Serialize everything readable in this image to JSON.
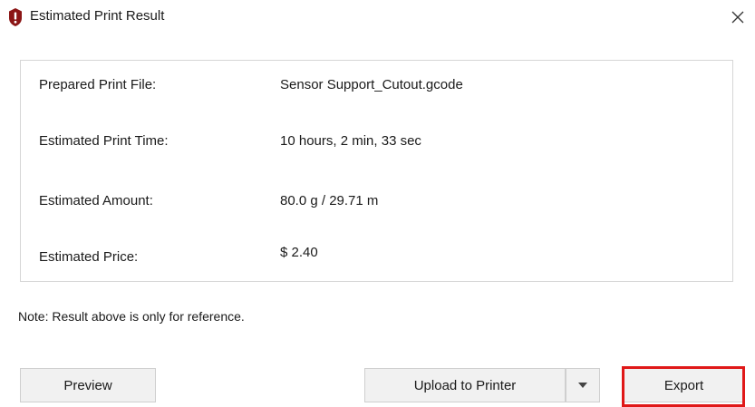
{
  "dialog": {
    "title": "Estimated Print Result",
    "icon": "alert-shield-icon",
    "close_icon": "close-icon"
  },
  "info": {
    "rows": [
      {
        "label": "Prepared Print File:",
        "value": "Sensor Support_Cutout.gcode"
      },
      {
        "label": "Estimated Print Time:",
        "value": "10 hours, 2 min, 33 sec"
      },
      {
        "label": "Estimated Amount:",
        "value": "80.0 g / 29.71 m"
      },
      {
        "label": "Estimated Price:",
        "value": "$ 2.40"
      }
    ]
  },
  "note": "Note: Result above is only for reference.",
  "buttons": {
    "preview": "Preview",
    "upload": "Upload to Printer",
    "dropdown_icon": "caret-down-icon",
    "export": "Export"
  },
  "colors": {
    "icon_red": "#8b1616",
    "highlight": "#e01818",
    "button_bg": "#f1f1f1",
    "panel_border": "#d6d6d6"
  }
}
